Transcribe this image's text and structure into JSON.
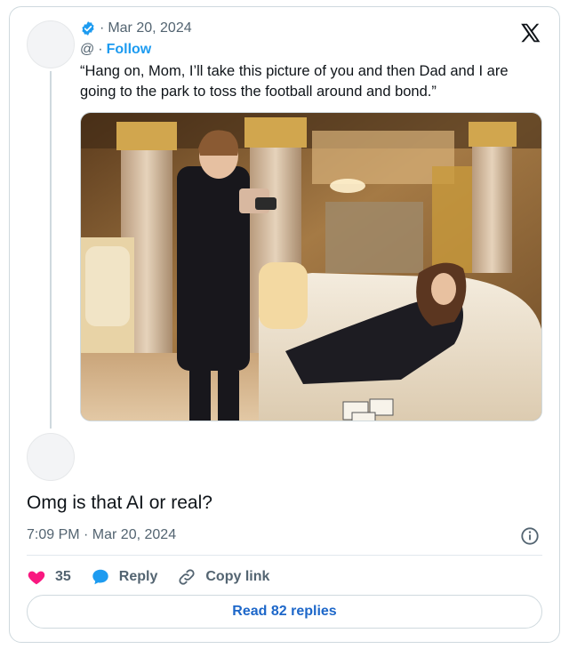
{
  "quoted_tweet": {
    "date": "Mar 20, 2024",
    "separator": "·",
    "handle": "@",
    "follow_label": "Follow",
    "text": "“Hang on, Mom, I’ll take this picture of you and then Dad and I are going to the park to toss the football around and bond.”",
    "media": {
      "kind": "photo"
    }
  },
  "reply": {
    "text": "Omg is that AI or real?",
    "timestamp": "7:09 PM · Mar 20, 2024"
  },
  "actions": {
    "like_count": "35",
    "reply_label": "Reply",
    "copy_link_label": "Copy link"
  },
  "read_replies_label": "Read 82 replies",
  "colors": {
    "accent": "#1d9bf0",
    "like": "#f91880",
    "muted_text": "#536471"
  },
  "icons": [
    "verified-badge-icon",
    "x-logo-icon",
    "info-icon",
    "heart-icon",
    "reply-bubble-icon",
    "link-icon"
  ]
}
